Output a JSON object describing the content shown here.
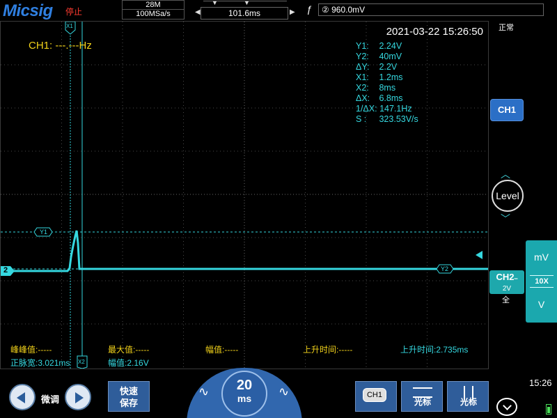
{
  "header": {
    "brand": "Micsig",
    "run_state": "停止",
    "memory_depth": "28M",
    "sample_rate": "100MSa/s",
    "timebase_delay": "101.6ms",
    "trigger_source_label": "② 960.0mV",
    "trigger_edge": "rising-edge-icon"
  },
  "screen": {
    "datetime": "2021-03-22 15:26:50",
    "frequency": "CH1: ---.---Hz",
    "cursor_marker_x1": "X1",
    "cursor_marker_x2": "X2",
    "cursor_marker_y1": "Y1",
    "cursor_marker_y2": "Y2",
    "channel_marker": "2"
  },
  "cursor_readout": [
    {
      "label": "Y1:",
      "value": "2.24V"
    },
    {
      "label": "Y2:",
      "value": "40mV"
    },
    {
      "label": "ΔY:",
      "value": "2.2V"
    },
    {
      "label": "X1:",
      "value": "1.2ms"
    },
    {
      "label": "X2:",
      "value": "8ms"
    },
    {
      "label": "ΔX:",
      "value": "6.8ms"
    },
    {
      "label": "1/ΔX:",
      "value": "147.1Hz"
    },
    {
      "label": "S :",
      "value": "323.53V/s"
    }
  ],
  "measurements": {
    "peak_to_peak": "峰峰值:-----",
    "max_value": "最大值:-----",
    "amplitude_ch1": "幅值:-----",
    "rise_time_ch1": "上升时间:-----",
    "rise_time_ch2": "上升时间:2.735ms",
    "positive_width": "正脉宽:3.021ms",
    "amplitude_ch2": "幅值:2.16V"
  },
  "side_panel": {
    "trigger_mode": "正常",
    "ch1_button": "CH1",
    "level_label": "Level",
    "ch2_label": "CH2",
    "ch2_scale": "2V",
    "ch2_coupling_suffix": "═",
    "ch2_bandwidth": "全",
    "scale_up_unit": "mV",
    "probe_ratio": "10X",
    "scale_down_unit": "V"
  },
  "bottom_bar": {
    "fine_label": "微调",
    "quick_save_line1": "快速",
    "quick_save_line2": "保存",
    "timebase_value": "20",
    "timebase_unit": "ms",
    "ch1_tag": "CH1",
    "hcursor_label": "光标",
    "vcursor_label": "光标",
    "clock": "15:26"
  },
  "colors": {
    "ch1_yellow": "#f2d21a",
    "ch2_cyan": "#35d8e0",
    "accent_blue": "#2f5d9a",
    "stopped_red": "#ff3b30"
  }
}
